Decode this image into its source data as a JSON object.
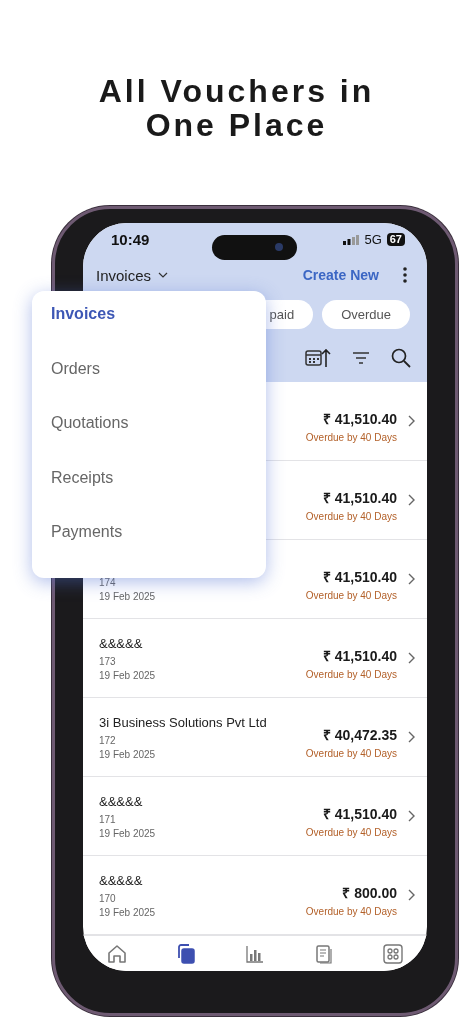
{
  "headline": [
    "All Vouchers in",
    "One Place"
  ],
  "status_bar": {
    "time": "10:49",
    "network": "5G",
    "battery": "67"
  },
  "header": {
    "title": "Invoices",
    "action": "Create New"
  },
  "chips": [
    {
      "label": "paid"
    },
    {
      "label": "Overdue"
    }
  ],
  "menu": [
    {
      "label": "Invoices",
      "selected": true
    },
    {
      "label": "Orders",
      "selected": false
    },
    {
      "label": "Quotations",
      "selected": false
    },
    {
      "label": "Receipts",
      "selected": false
    },
    {
      "label": "Payments",
      "selected": false
    }
  ],
  "rows": [
    {
      "amount": "₹ 41,510.40",
      "status": "Overdue by 40 Days"
    },
    {
      "amount": "₹ 41,510.40",
      "status": "Overdue by 40 Days"
    },
    {
      "number": "174",
      "date": "19 Feb 2025",
      "amount": "₹ 41,510.40",
      "status": "Overdue by 40 Days"
    },
    {
      "name": "&&&&&",
      "number": "173",
      "date": "19 Feb 2025",
      "amount": "₹ 41,510.40",
      "status": "Overdue by 40 Days"
    },
    {
      "name": "3i Business Solutions Pvt Ltd",
      "number": "172",
      "date": "19 Feb 2025",
      "amount": "₹ 40,472.35",
      "status": "Overdue by 40 Days"
    },
    {
      "name": "&&&&&",
      "number": "171",
      "date": "19 Feb 2025",
      "amount": "₹ 41,510.40",
      "status": "Overdue by 40 Days"
    },
    {
      "name": "&&&&&",
      "number": "170",
      "date": "19 Feb 2025",
      "amount": "₹ 800.00",
      "status": "Overdue by 40 Days"
    }
  ],
  "nav": [
    {
      "kind": "home",
      "selected": false
    },
    {
      "kind": "vouchers",
      "selected": true
    },
    {
      "kind": "reports",
      "selected": false
    },
    {
      "kind": "masters",
      "selected": false
    },
    {
      "kind": "more",
      "selected": false
    }
  ]
}
